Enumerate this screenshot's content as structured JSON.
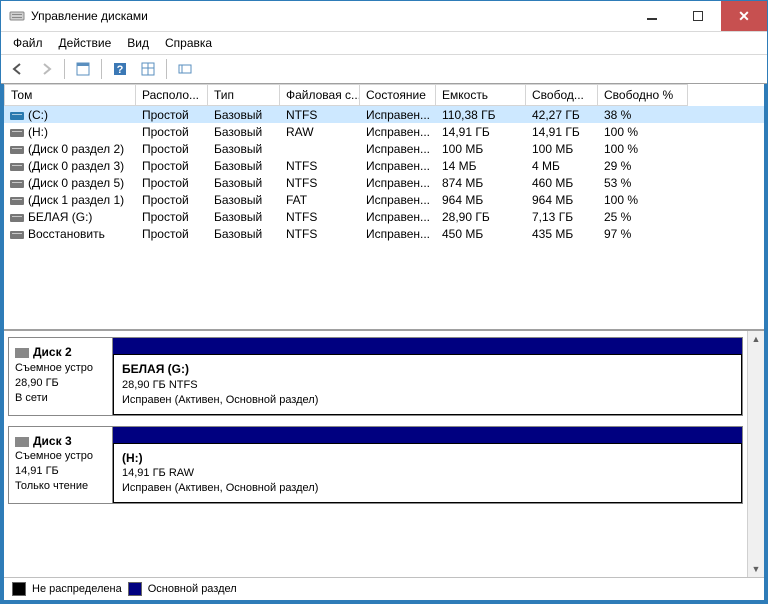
{
  "window": {
    "title": "Управление дисками"
  },
  "menu": [
    "Файл",
    "Действие",
    "Вид",
    "Справка"
  ],
  "columns": [
    "Том",
    "Располо...",
    "Тип",
    "Файловая с...",
    "Состояние",
    "Емкость",
    "Свобод...",
    "Свободно %"
  ],
  "volumes": [
    {
      "name": "(C:)",
      "layout": "Простой",
      "type": "Базовый",
      "fs": "NTFS",
      "status": "Исправен...",
      "cap": "110,38 ГБ",
      "free": "42,27 ГБ",
      "pct": "38 %",
      "selected": true,
      "color": "#2a7ab0"
    },
    {
      "name": "(H:)",
      "layout": "Простой",
      "type": "Базовый",
      "fs": "RAW",
      "status": "Исправен...",
      "cap": "14,91 ГБ",
      "free": "14,91 ГБ",
      "pct": "100 %",
      "color": "#777"
    },
    {
      "name": "(Диск 0 раздел 2)",
      "layout": "Простой",
      "type": "Базовый",
      "fs": "",
      "status": "Исправен...",
      "cap": "100 МБ",
      "free": "100 МБ",
      "pct": "100 %",
      "color": "#777"
    },
    {
      "name": "(Диск 0 раздел 3)",
      "layout": "Простой",
      "type": "Базовый",
      "fs": "NTFS",
      "status": "Исправен...",
      "cap": "14 МБ",
      "free": "4 МБ",
      "pct": "29 %",
      "color": "#777"
    },
    {
      "name": "(Диск 0 раздел 5)",
      "layout": "Простой",
      "type": "Базовый",
      "fs": "NTFS",
      "status": "Исправен...",
      "cap": "874 МБ",
      "free": "460 МБ",
      "pct": "53 %",
      "color": "#777"
    },
    {
      "name": "(Диск 1 раздел 1)",
      "layout": "Простой",
      "type": "Базовый",
      "fs": "FAT",
      "status": "Исправен...",
      "cap": "964 МБ",
      "free": "964 МБ",
      "pct": "100 %",
      "color": "#777"
    },
    {
      "name": "БЕЛАЯ (G:)",
      "layout": "Простой",
      "type": "Базовый",
      "fs": "NTFS",
      "status": "Исправен...",
      "cap": "28,90 ГБ",
      "free": "7,13 ГБ",
      "pct": "25 %",
      "color": "#777"
    },
    {
      "name": "Восстановить",
      "layout": "Простой",
      "type": "Базовый",
      "fs": "NTFS",
      "status": "Исправен...",
      "cap": "450 МБ",
      "free": "435 МБ",
      "pct": "97 %",
      "color": "#777"
    }
  ],
  "disks": [
    {
      "label": "Диск 2",
      "type": "Съемное устро",
      "size": "28,90 ГБ",
      "state": "В сети",
      "part": {
        "title": "БЕЛАЯ  (G:)",
        "sub": "28,90 ГБ NTFS",
        "status": "Исправен (Активен, Основной раздел)"
      }
    },
    {
      "label": "Диск 3",
      "type": "Съемное устро",
      "size": "14,91 ГБ",
      "state": "Только чтение",
      "part": {
        "title": "(H:)",
        "sub": "14,91 ГБ RAW",
        "status": "Исправен (Активен, Основной раздел)"
      }
    }
  ],
  "legend": [
    {
      "color": "#000",
      "label": "Не распределена"
    },
    {
      "color": "#000080",
      "label": "Основной раздел"
    }
  ]
}
